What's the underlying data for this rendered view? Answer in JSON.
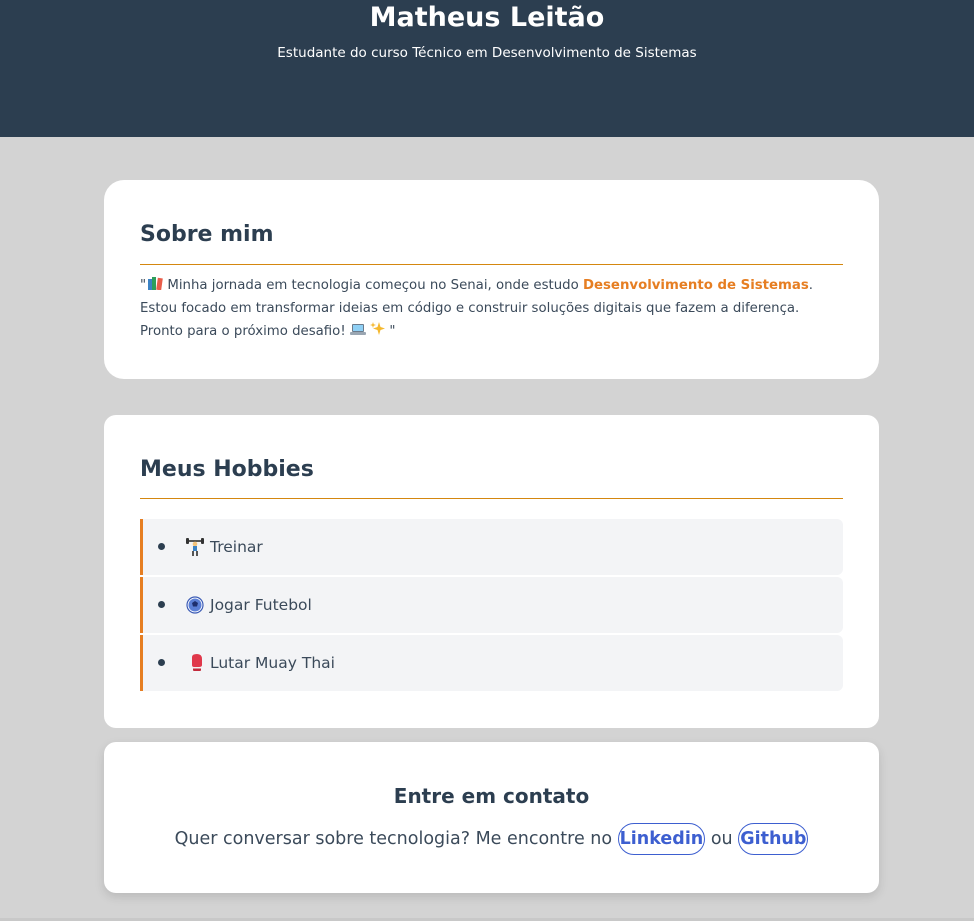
{
  "header": {
    "name": "Matheus Leitão",
    "subtitle": "Estudante do curso Técnico em Desenvolvimento de Sistemas"
  },
  "about": {
    "title": "Sobre mim",
    "quote_open": "\"",
    "text_before": " Minha jornada em tecnologia começou no Senai, onde estudo ",
    "highlight": "Desenvolvimento de Sistemas",
    "text_after": ". Estou focado em transformar ideias em código e construir soluções digitais que fazem a diferença. Pronto para o próximo desafio! ",
    "quote_close": " \"",
    "icons": [
      "books-icon",
      "laptop-icon",
      "sparkles-icon"
    ]
  },
  "hobbies": {
    "title": "Meus Hobbies",
    "items": [
      {
        "label": "Treinar",
        "icon": "weightlifting-icon"
      },
      {
        "label": "Jogar Futebol",
        "icon": "soccer-ball-icon"
      },
      {
        "label": "Lutar Muay Thai",
        "icon": "boxing-glove-icon"
      }
    ]
  },
  "contact": {
    "title": "Entre em contato",
    "text": "Quer conversar sobre tecnologia? Me encontre no ",
    "linkedin_label": "Linkedin",
    "separator": " ou ",
    "github_label": "Github"
  },
  "colors": {
    "header_bg": "#2c3e50",
    "page_bg": "#d3d3d3",
    "accent": "#e67e22",
    "link": "#3d5fd0"
  }
}
